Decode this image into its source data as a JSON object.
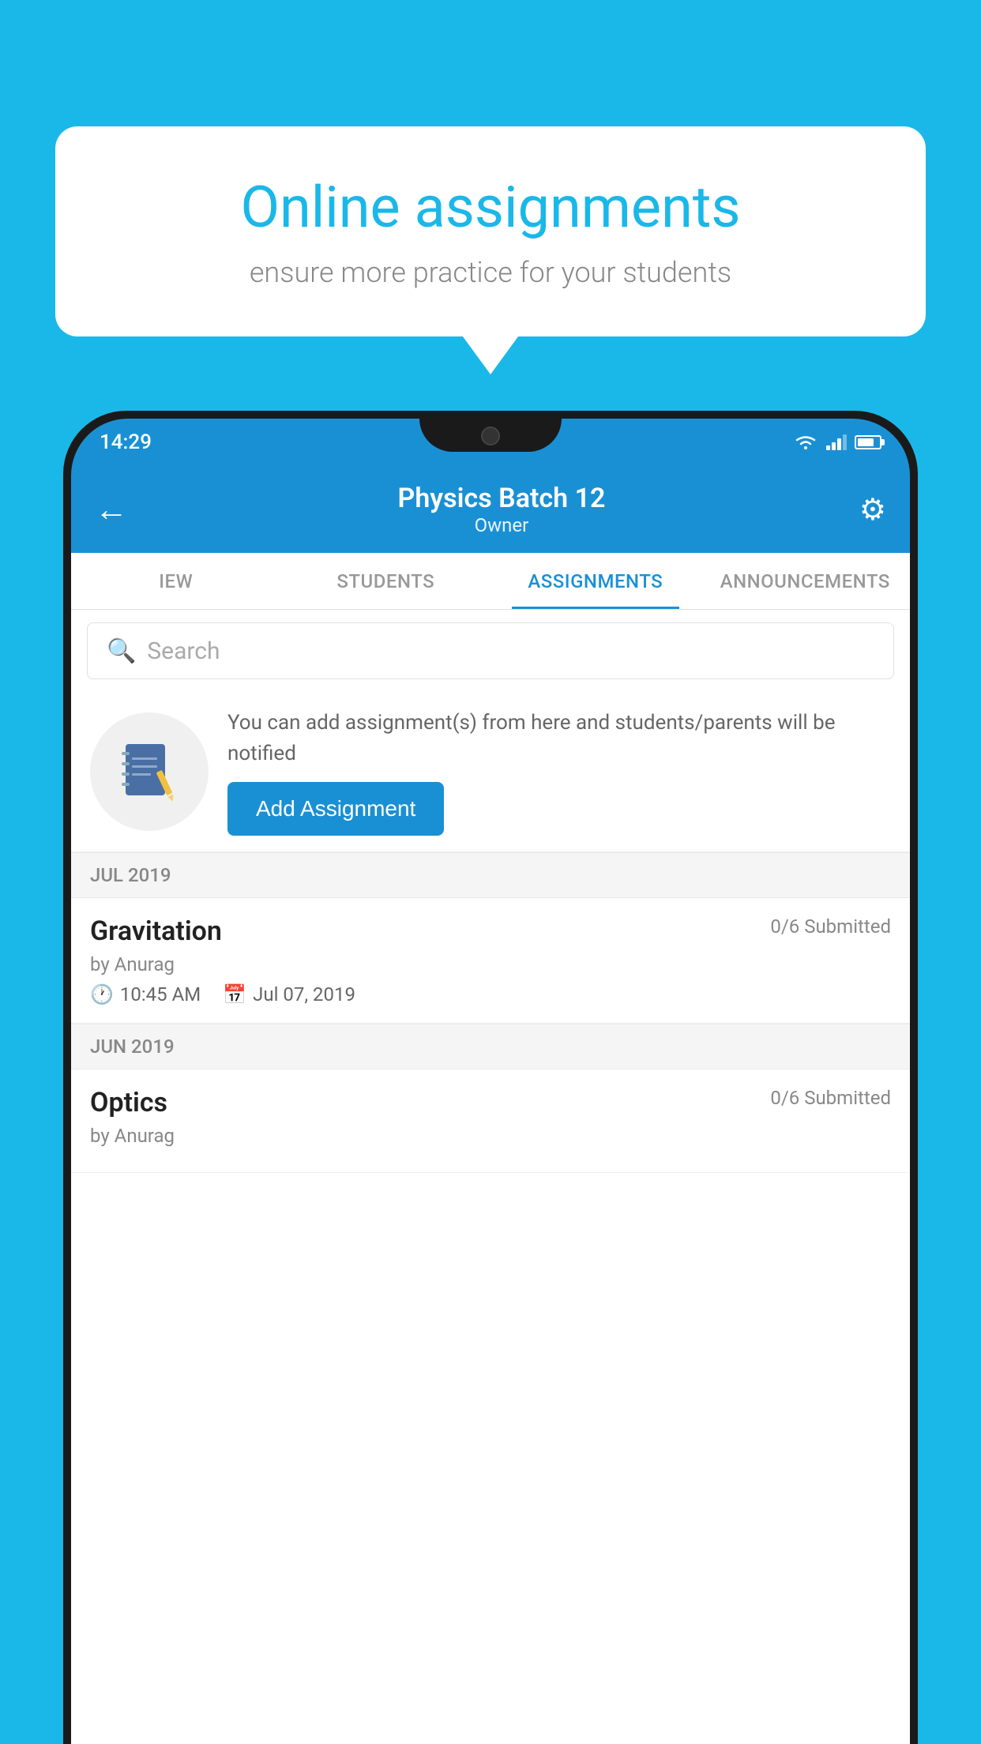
{
  "background": {
    "color": "#1ab8e8"
  },
  "speech_bubble": {
    "title": "Online assignments",
    "subtitle": "ensure more practice for your students"
  },
  "status_bar": {
    "time": "14:29"
  },
  "app_header": {
    "title": "Physics Batch 12",
    "subtitle": "Owner",
    "back_label": "←",
    "settings_label": "⚙"
  },
  "tabs": [
    {
      "label": "IEW",
      "active": false
    },
    {
      "label": "STUDENTS",
      "active": false
    },
    {
      "label": "ASSIGNMENTS",
      "active": true
    },
    {
      "label": "ANNOUNCEMENTS",
      "active": false
    }
  ],
  "search": {
    "placeholder": "Search"
  },
  "promo": {
    "text": "You can add assignment(s) from here and students/parents will be notified",
    "button_label": "Add Assignment"
  },
  "sections": [
    {
      "label": "JUL 2019",
      "assignments": [
        {
          "name": "Gravitation",
          "submitted": "0/6 Submitted",
          "by": "by Anurag",
          "time": "10:45 AM",
          "date": "Jul 07, 2019"
        }
      ]
    },
    {
      "label": "JUN 2019",
      "assignments": [
        {
          "name": "Optics",
          "submitted": "0/6 Submitted",
          "by": "by Anurag",
          "time": "",
          "date": ""
        }
      ]
    }
  ]
}
